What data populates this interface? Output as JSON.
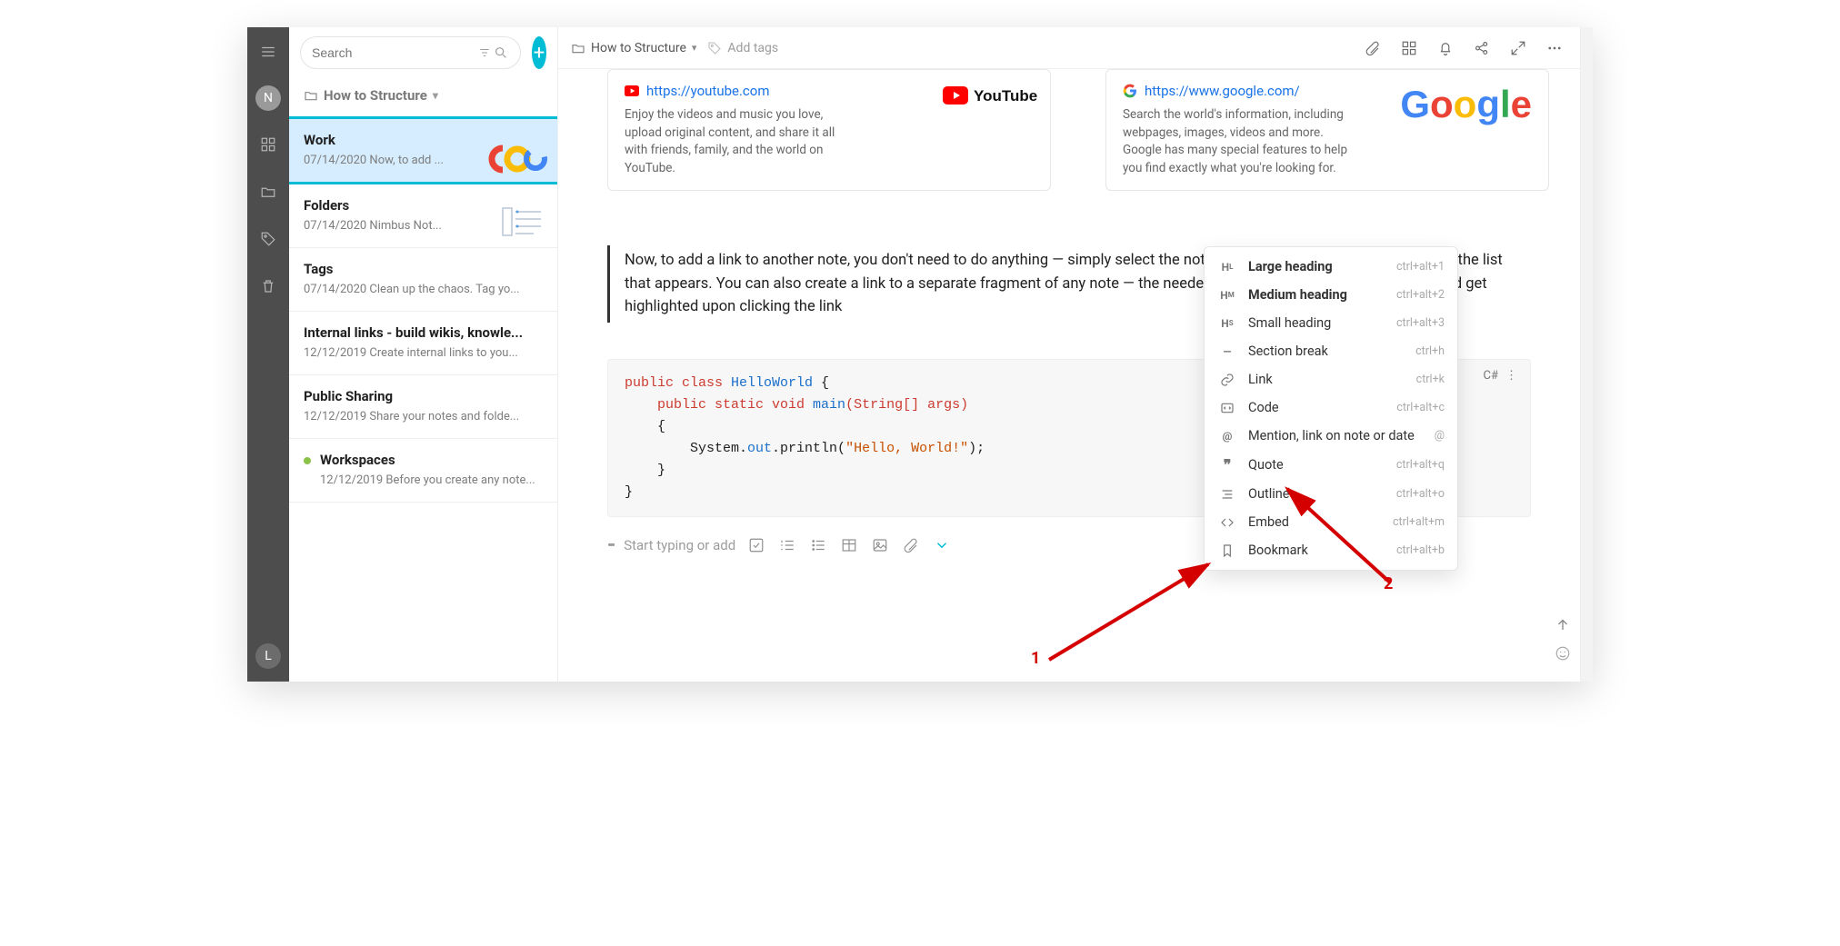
{
  "rail": {
    "avatar_top": "N",
    "avatar_bottom": "L"
  },
  "sidebar": {
    "search_placeholder": "Search",
    "breadcrumb": "How to Structure",
    "items": [
      {
        "title": "Work",
        "date": "07/14/2020",
        "preview": "Now, to add ...",
        "selected": true,
        "thumb": "google"
      },
      {
        "title": "Folders",
        "date": "07/14/2020",
        "preview": "Nimbus Not...",
        "thumb": "list"
      },
      {
        "title": "Tags",
        "date": "07/14/2020",
        "preview": "Clean up the chaos. Tag yo..."
      },
      {
        "title": "Internal links - build wikis, knowle...",
        "date": "12/12/2019",
        "preview": "Create internal links to you..."
      },
      {
        "title": "Public Sharing",
        "date": "12/12/2019",
        "preview": "Share your notes and folde..."
      },
      {
        "title": "Workspaces",
        "date": "12/12/2019",
        "preview": "Before you create any note...",
        "dot": true
      }
    ]
  },
  "topbar": {
    "folder": "How to Structure",
    "add_tags": "Add tags"
  },
  "cards": {
    "youtube": {
      "url": "https://youtube.com",
      "desc": "Enjoy the videos and music you love, upload original content, and share it all with friends, family, and the world on YouTube.",
      "brand": "YouTube"
    },
    "google": {
      "url": "https://www.google.com/",
      "desc": "Search the world's information, including webpages, images, videos and more. Google has many special features to help you find exactly what you're looking for."
    }
  },
  "quote": "Now, to add a link to another note, you don't need to do anything — simply select the note, folder, or workspace you need from the list that appears. You can also create a link to a separate fragment of any note — the needed fragment will open automatically and get highlighted upon clicking the link",
  "code": {
    "language": "C#",
    "line1a": "public class ",
    "line1b": "HelloWorld",
    "line1c": " {",
    "line2a": "    public static void ",
    "line2b": "main",
    "line2c": "(String[] args)",
    "line3": "    {",
    "line4a": "        System.",
    "line4b": "out",
    "line4c": ".println(",
    "line4d": "\"Hello, World!\"",
    "line4e": ");",
    "line5": "    }",
    "line6": "}"
  },
  "type_row": {
    "placeholder": "Start typing or add"
  },
  "menu": {
    "items": [
      {
        "icon": "HL",
        "label": "Large heading",
        "shortcut": "ctrl+alt+1",
        "bold": true
      },
      {
        "icon": "HM",
        "label": "Medium heading",
        "shortcut": "ctrl+alt+2",
        "bold": true
      },
      {
        "icon": "HS",
        "label": "Small heading",
        "shortcut": "ctrl+alt+3"
      },
      {
        "icon": "—",
        "label": "Section break",
        "shortcut": "ctrl+h"
      },
      {
        "icon": "link",
        "label": "Link",
        "shortcut": "ctrl+k"
      },
      {
        "icon": "code",
        "label": "Code",
        "shortcut": "ctrl+alt+c"
      },
      {
        "icon": "@",
        "label": "Mention, link on note or date",
        "shortcut": "@"
      },
      {
        "icon": "quote",
        "label": "Quote",
        "shortcut": "ctrl+alt+q"
      },
      {
        "icon": "outline",
        "label": "Outline",
        "shortcut": "ctrl+alt+o"
      },
      {
        "icon": "embed",
        "label": "Embed",
        "shortcut": "ctrl+alt+m"
      },
      {
        "icon": "bookmark",
        "label": "Bookmark",
        "shortcut": "ctrl+alt+b"
      }
    ]
  },
  "annotations": {
    "label1": "1",
    "label2": "2"
  }
}
